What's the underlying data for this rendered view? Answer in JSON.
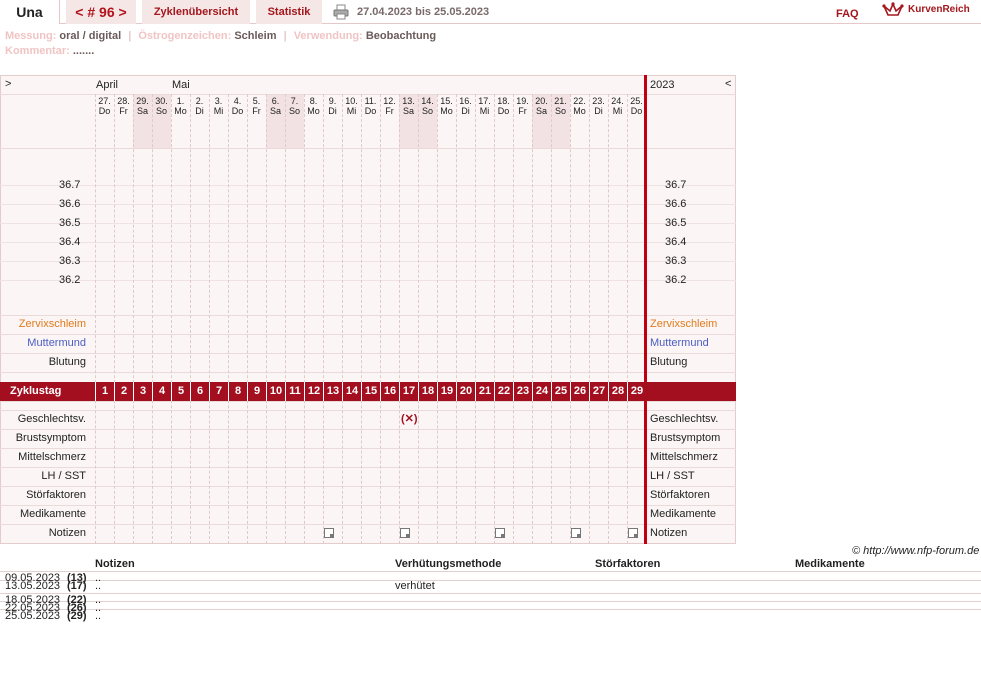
{
  "header": {
    "name": "Una",
    "cycle": "< # 96 >",
    "tab_overview": "Zyklenübersicht",
    "tab_stat": "Statistik",
    "range": "27.04.2023 bis 25.05.2023",
    "faq": "FAQ",
    "logo": "KurvenReich"
  },
  "info": {
    "messung_label": "Messung:",
    "messung_value": "oral / digital",
    "oestrogen_label": "Östrogenzeichen:",
    "oestrogen_value": "Schleim",
    "verwendung_label": "Verwendung:",
    "verwendung_value": "Beobachtung",
    "kommentar_label": "Kommentar:",
    "kommentar_value": "......."
  },
  "chart": {
    "arrow_left": ">",
    "arrow_right": "<",
    "month_april": "April",
    "month_mai": "Mai",
    "year": "2023",
    "days": [
      {
        "d": "27.",
        "w": "Do"
      },
      {
        "d": "28.",
        "w": "Fr"
      },
      {
        "d": "29.",
        "w": "Sa"
      },
      {
        "d": "30.",
        "w": "So"
      },
      {
        "d": "1.",
        "w": "Mo"
      },
      {
        "d": "2.",
        "w": "Di"
      },
      {
        "d": "3.",
        "w": "Mi"
      },
      {
        "d": "4.",
        "w": "Do"
      },
      {
        "d": "5.",
        "w": "Fr"
      },
      {
        "d": "6.",
        "w": "Sa"
      },
      {
        "d": "7.",
        "w": "So"
      },
      {
        "d": "8.",
        "w": "Mo"
      },
      {
        "d": "9.",
        "w": "Di"
      },
      {
        "d": "10.",
        "w": "Mi"
      },
      {
        "d": "11.",
        "w": "Do"
      },
      {
        "d": "12.",
        "w": "Fr"
      },
      {
        "d": "13.",
        "w": "Sa"
      },
      {
        "d": "14.",
        "w": "So"
      },
      {
        "d": "15.",
        "w": "Mo"
      },
      {
        "d": "16.",
        "w": "Di"
      },
      {
        "d": "17.",
        "w": "Mi"
      },
      {
        "d": "18.",
        "w": "Do"
      },
      {
        "d": "19.",
        "w": "Fr"
      },
      {
        "d": "20.",
        "w": "Sa"
      },
      {
        "d": "21.",
        "w": "So"
      },
      {
        "d": "22.",
        "w": "Mo"
      },
      {
        "d": "23.",
        "w": "Di"
      },
      {
        "d": "24.",
        "w": "Mi"
      },
      {
        "d": "25.",
        "w": "Do"
      }
    ],
    "weekend_indices": [
      2,
      3,
      9,
      10,
      16,
      17,
      23,
      24
    ],
    "temps": [
      "36.7",
      "36.6",
      "36.5",
      "36.4",
      "36.3",
      "36.2"
    ],
    "rows_upper": [
      {
        "label": "Zervixschleim",
        "color": "#e07b1a"
      },
      {
        "label": "Muttermund",
        "color": "#4a5cc4"
      },
      {
        "label": "Blutung",
        "color": "#222222"
      }
    ],
    "zyklustag_label": "Zyklustag",
    "cycle_days": [
      "1",
      "2",
      "3",
      "4",
      "5",
      "6",
      "7",
      "8",
      "9",
      "10",
      "11",
      "12",
      "13",
      "14",
      "15",
      "16",
      "17",
      "18",
      "19",
      "20",
      "21",
      "22",
      "23",
      "24",
      "25",
      "26",
      "27",
      "28",
      "29"
    ],
    "rows_lower": [
      "Geschlechtsv.",
      "Brustsymptom",
      "Mittelschmerz",
      "LH / SST",
      "Störfaktoren",
      "Medikamente",
      "Notizen"
    ],
    "geschlechtsv_mark": "(✕)",
    "geschlechtsv_day_index": 16,
    "note_day_indices": [
      12,
      16,
      21,
      25,
      28
    ],
    "accent": "#a30f1f"
  },
  "credit": "© http://www.nfp-forum.de",
  "table": {
    "headers": [
      "Notizen",
      "Verhütungsmethode",
      "Störfaktoren",
      "Medikamente"
    ],
    "rows": [
      {
        "date": "09.05.2023",
        "day": "(13)",
        "note": "..",
        "method": ""
      },
      {
        "date": "13.05.2023",
        "day": "(17)",
        "note": "..",
        "method": "verhütet"
      },
      {
        "date": "18.05.2023",
        "day": "(22)",
        "note": "..",
        "method": ""
      },
      {
        "date": "22.05.2023",
        "day": "(26)",
        "note": "..",
        "method": ""
      },
      {
        "date": "25.05.2023",
        "day": "(29)",
        "note": "..",
        "method": ""
      }
    ]
  }
}
